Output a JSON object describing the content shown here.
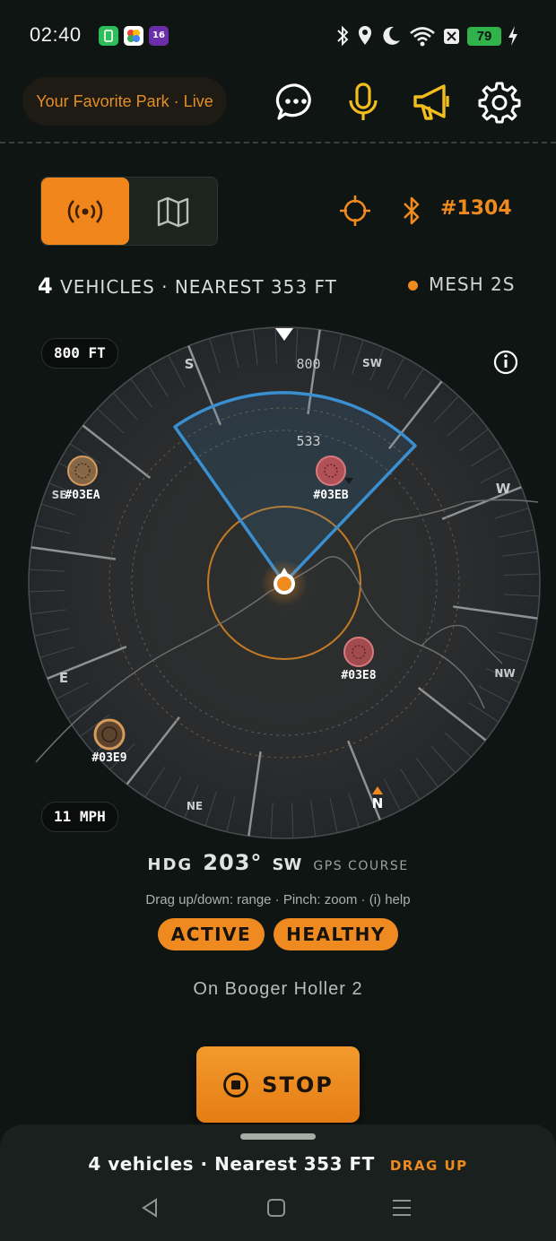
{
  "status_bar": {
    "time": "02:40",
    "notification_badge": "16",
    "battery": "79",
    "icons": [
      "bluetooth-icon",
      "location-icon",
      "moon-icon",
      "wifi-icon",
      "x-icon",
      "battery-icon",
      "charging-icon"
    ]
  },
  "header": {
    "park_label": "Your Favorite Park · Live",
    "buttons": [
      "chat-icon",
      "microphone-icon",
      "megaphone-icon",
      "settings-icon"
    ]
  },
  "toolbar": {
    "mode_active": "radar",
    "device_id": "#1304"
  },
  "summary": {
    "count": "4",
    "label": "VEHICLES · NEAREST 353 FT",
    "mesh": "MESH 2S"
  },
  "radar": {
    "range_chip": "800 FT",
    "speed_chip": "11 MPH",
    "ring_labels": [
      "800",
      "533"
    ],
    "compass": {
      "S": "S",
      "SW": "SW",
      "W": "W",
      "NW": "NW",
      "N": "N",
      "NE": "NE",
      "E": "E",
      "SE": "SE"
    },
    "vehicles": [
      {
        "id": "#03EA"
      },
      {
        "id": "#03EB"
      },
      {
        "id": "#03E8"
      },
      {
        "id": "#03E9"
      }
    ],
    "colors": {
      "accent": "#ef8a1f",
      "sector": "#3a8fd0",
      "vehicle_red": "#c8555a"
    }
  },
  "heading": {
    "label": "HDG",
    "value": "203°",
    "direction": "SW",
    "source": "GPS COURSE"
  },
  "hint": "Drag up/down: range · Pinch: zoom · (i) help",
  "badges": {
    "active": "ACTIVE",
    "healthy": "HEALTHY"
  },
  "trail": "On Booger Holler 2",
  "stop_label": "STOP",
  "bottom_sheet": {
    "summary": "4 vehicles · Nearest 353 FT",
    "drag_up": "DRAG UP"
  }
}
